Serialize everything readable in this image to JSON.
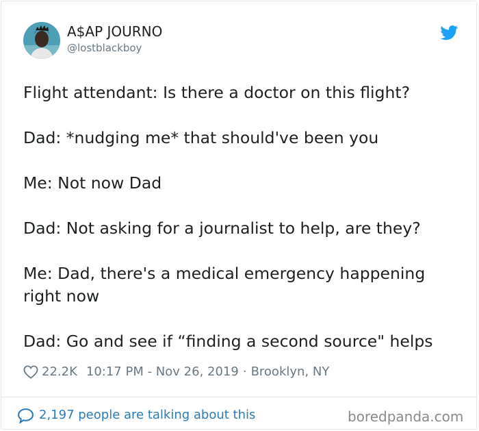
{
  "author": {
    "name": "A$AP JOURNO",
    "handle": "@lostblackboy"
  },
  "tweet": {
    "lines": [
      "Flight attendant: Is there a doctor on this flight?",
      "",
      "Dad: *nudging me* that should've been you",
      "",
      "Me: Not now Dad",
      "",
      "Dad: Not asking for a journalist to help, are they?",
      "",
      "Me: Dad, there's a medical emergency happening",
      "right now",
      "",
      "Dad: Go and see if “finding a second source\" helps"
    ]
  },
  "meta": {
    "likes": "22.2K",
    "timestamp": "10:17 PM - Nov 26, 2019",
    "separator": "·",
    "location": "Brooklyn, NY"
  },
  "footer": {
    "talking": "2,197 people are talking about this",
    "watermark": "boredpanda.com"
  },
  "icons": {
    "bird": "twitter-bird-icon",
    "heart": "heart-outline-icon",
    "bubble": "speech-bubble-icon"
  },
  "colors": {
    "twitter_blue": "#1da1f2",
    "link_blue": "#2b7bb9",
    "secondary_text": "#697882",
    "primary_text": "#1c2022"
  }
}
